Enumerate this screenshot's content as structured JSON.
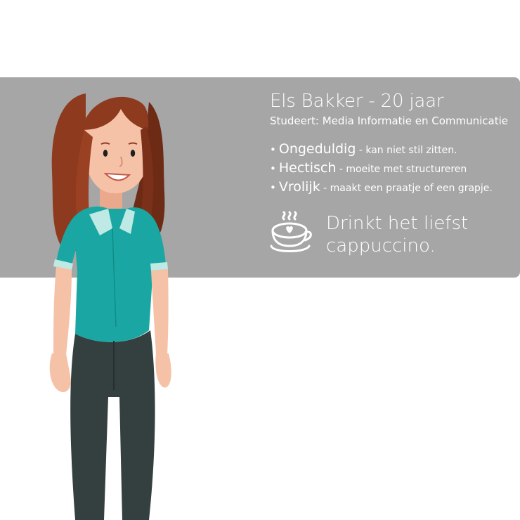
{
  "profile": {
    "name": "Els Bakker - 20 jaar",
    "study": "Studeert: Media Informatie en Communicatie",
    "traits": [
      {
        "title": "Ongeduldig",
        "desc": " - kan niet stil zitten."
      },
      {
        "title": "Hectisch",
        "desc": " - moeite met structureren"
      },
      {
        "title": "Vrolijk",
        "desc": " - maakt een praatje of een grapje."
      }
    ],
    "drink_text": "Drinkt het liefst cappuccino.",
    "bullet": "•"
  },
  "colors": {
    "card": "#a6a6a6",
    "text": "#ffffff",
    "hair": "#8e3a1f",
    "shirt": "#1aa7a3",
    "collar": "#bfe9e4",
    "skin": "#f6c2a7",
    "pants": "#343f40"
  },
  "icons": {
    "drink": "cappuccino-cup-icon",
    "character": "persona-illustration"
  }
}
